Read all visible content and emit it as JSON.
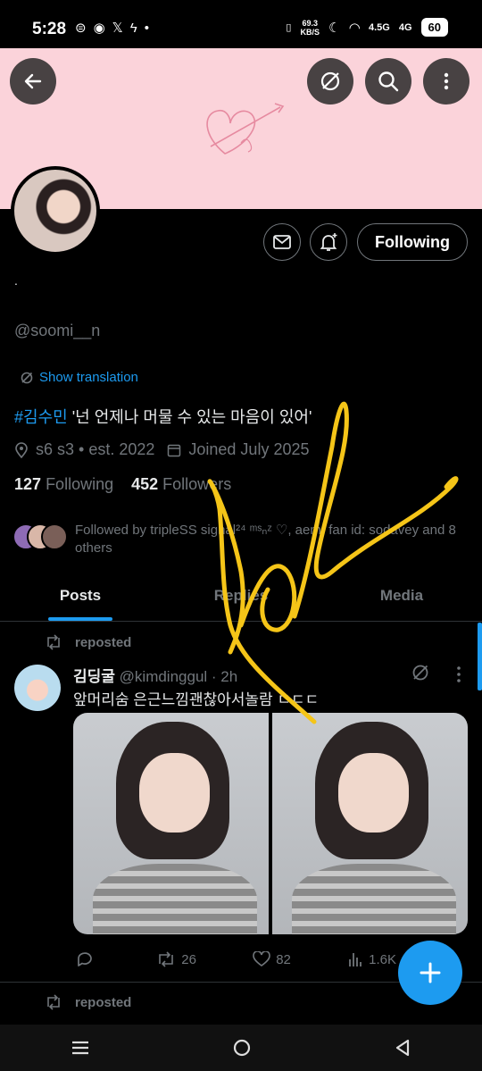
{
  "status_bar": {
    "time": "5:28",
    "net_speed_value": "69.3",
    "net_speed_unit": "KB/S",
    "network_labels": [
      "4.5G",
      "4G"
    ],
    "battery": "60"
  },
  "profile": {
    "display_name": ".",
    "handle": "@soomi__n",
    "show_translation": "Show translation",
    "bio_hashtag": "#김수민",
    "bio_text": " '넌 언제나 머물 수 있는 마음이 있어'",
    "location": "s6 s3 • est. 2022",
    "joined": "Joined July 2025",
    "following_count": "127",
    "following_label": "Following",
    "followers_count": "452",
    "followers_label": "Followers",
    "followed_by": "Followed by tripleSS signal²⁴ ᵐˢₙᶻ ♡, aem, fan id: sodavey and 8 others",
    "following_button": "Following"
  },
  "tabs": [
    {
      "label": "Posts",
      "active": true
    },
    {
      "label": "Replies",
      "active": false
    },
    {
      "label": "Media",
      "active": false
    }
  ],
  "posts": [
    {
      "repost_label": "reposted",
      "author_name": "김딩굴",
      "author_handle": "@kimdinggul",
      "time": " · 2h",
      "text": "앞머리숨 은근느낌괜찮아서놀람 ㄷㄷㄷ",
      "replies": "",
      "reposts": "26",
      "likes": "82",
      "views": "1.6K"
    }
  ],
  "next_repost_label": "reposted",
  "colors": {
    "accent": "#1d9bf0",
    "banner": "#fbd3da",
    "annotation": "#f5c518"
  }
}
